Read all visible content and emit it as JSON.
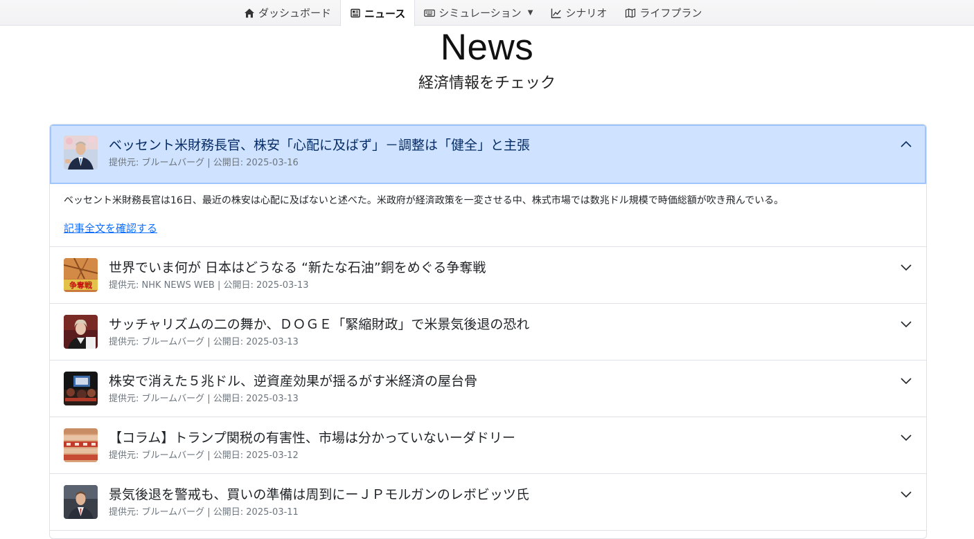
{
  "nav": {
    "items": [
      {
        "label": "ダッシュボード",
        "icon": "house-icon"
      },
      {
        "label": "ニュース",
        "icon": "newspaper-icon",
        "active": true
      },
      {
        "label": "シミュレーション",
        "icon": "keyboard-icon",
        "dropdown": true
      },
      {
        "label": "シナリオ",
        "icon": "line-chart-icon"
      },
      {
        "label": "ライフプラン",
        "icon": "map-icon"
      }
    ]
  },
  "header": {
    "title": "News",
    "subtitle": "経済情報をチェック"
  },
  "news": {
    "items": [
      {
        "title": "ベッセント米財務長官、株安「心配に及ばず」－調整は「健全」と主張",
        "meta": "提供元: ブルームバーグ | 公開日: 2025-03-16",
        "summary": "ベッセント米財務長官は16日、最近の株安は心配に及ばないと述べた。米政府が経済政策を一変させる中、株式市場では数兆ドル規模で時価総額が吹き飛んでいる。",
        "link": "記事全文を確認する",
        "expanded": true
      },
      {
        "title": "世界でいま何が 日本はどうなる “新たな石油”銅をめぐる争奪戦",
        "meta": "提供元: NHK NEWS WEB | 公開日: 2025-03-13",
        "thumb_text": "争奪戦"
      },
      {
        "title": "サッチャリズムの二の舞か、ＤＯＧＥ「緊縮財政」で米景気後退の恐れ",
        "meta": "提供元: ブルームバーグ | 公開日: 2025-03-13"
      },
      {
        "title": "株安で消えた５兆ドル、逆資産効果が揺るがす米経済の屋台骨",
        "meta": "提供元: ブルームバーグ | 公開日: 2025-03-13"
      },
      {
        "title": "【コラム】トランプ関税の有害性、市場は分かっていないーダドリー",
        "meta": "提供元: ブルームバーグ | 公開日: 2025-03-12"
      },
      {
        "title": "景気後退を警戒も、買いの準備は周到にーＪＰモルガンのレボビッツ氏",
        "meta": "提供元: ブルームバーグ | 公開日: 2025-03-11"
      }
    ]
  },
  "colors": {
    "accent": "#0d6efd",
    "expanded_bg": "#cfe2ff",
    "expanded_title": "#052c65",
    "meta": "#6c757d"
  }
}
